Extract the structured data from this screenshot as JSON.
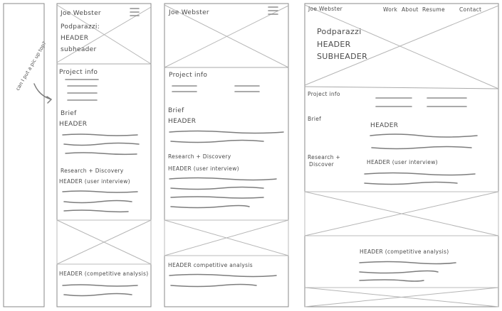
{
  "annotation": {
    "text": "can I put a pic up top?"
  },
  "mobile_a": {
    "name": "Joe Webster",
    "menu_icon": "hamburger-icon",
    "hero": [
      "Podparazzi:",
      "HEADER",
      "subheader"
    ],
    "project_info": "Project info",
    "brief": "Brief",
    "brief_header": "HEADER",
    "research": "Research + Discovery",
    "research_header": "HEADER (user interview)",
    "competitive_header": "HEADER (competitive analysis)"
  },
  "mobile_b": {
    "name": "Joe Webster",
    "menu_icon": "hamburger-icon",
    "project_info": "Project info",
    "brief": "Brief",
    "brief_header": "HEADER",
    "research": "Research + Discovery",
    "research_header": "HEADER (user interview)",
    "competitive_header": "HEADER competitive analysis"
  },
  "desktop": {
    "name": "Joe Webster",
    "nav": [
      "Work",
      "About",
      "Resume",
      "Contact"
    ],
    "hero": [
      "Podparazzi",
      "HEADER",
      "SUBHEADER"
    ],
    "project_info": "Project info",
    "brief": "Brief",
    "brief_header": "HEADER",
    "research": [
      "Research +",
      "Discover"
    ],
    "research_header": "HEADER (user interview)",
    "competitive_header": "HEADER (competitive analysis)"
  }
}
